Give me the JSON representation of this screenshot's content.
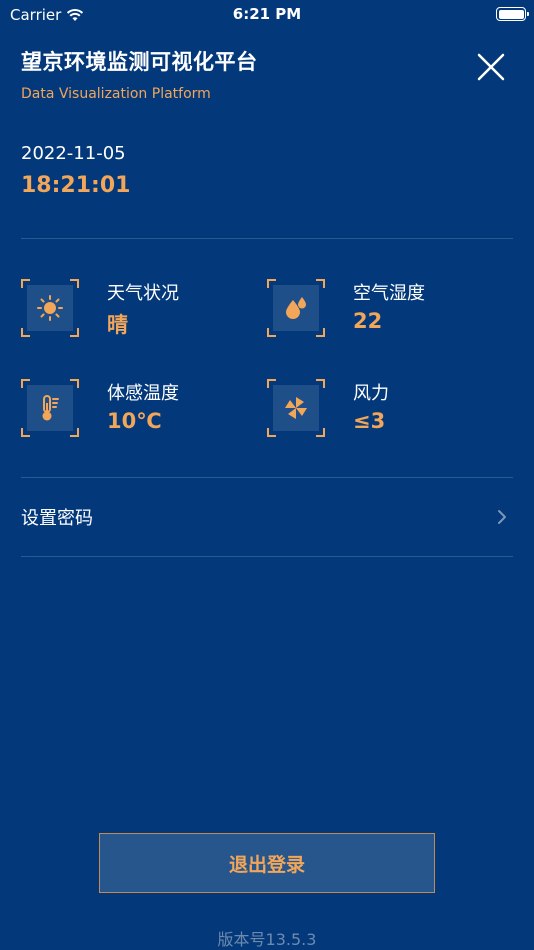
{
  "status_bar": {
    "carrier": "Carrier",
    "time": "6:21 PM"
  },
  "header": {
    "title": "望京环境监测可视化平台",
    "subtitle": "Data Visualization Platform",
    "close_icon": "close-icon"
  },
  "datetime": {
    "date": "2022-11-05",
    "time": "18:21:01"
  },
  "metrics": [
    {
      "label": "天气状况",
      "value": "晴",
      "icon": "sun-icon"
    },
    {
      "label": "空气湿度",
      "value": "22",
      "icon": "water-drops-icon"
    },
    {
      "label": "体感温度",
      "value": "10℃",
      "icon": "thermometer-icon"
    },
    {
      "label": "风力",
      "value": "≤3",
      "icon": "pinwheel-icon"
    }
  ],
  "settings": {
    "password_label": "设置密码"
  },
  "logout": {
    "label": "退出登录"
  },
  "version": "版本号13.5.3",
  "colors": {
    "background": "#03397A",
    "accent": "#F2A65A",
    "divider": "#2A5A93"
  }
}
